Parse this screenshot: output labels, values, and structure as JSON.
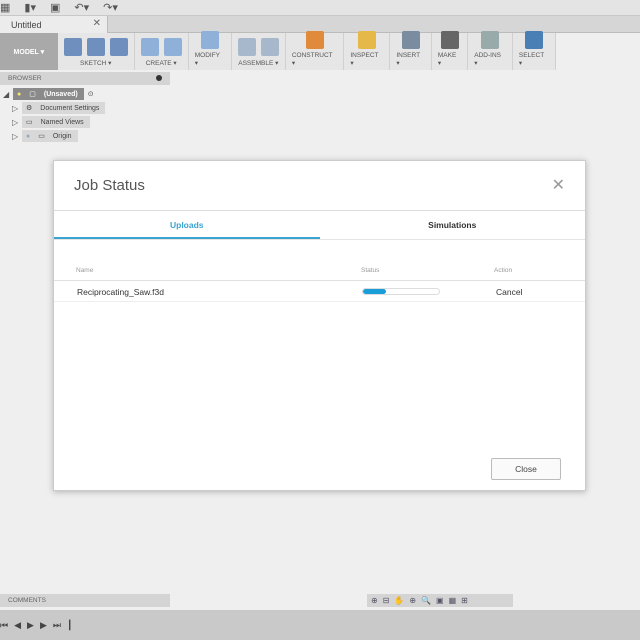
{
  "app": {
    "doc_tab": "Untitled",
    "quick": [
      "grid-icon",
      "file-icon",
      "save-icon",
      "undo-icon",
      "redo-icon"
    ]
  },
  "toolbar": {
    "workspace": "MODEL ▾",
    "groups": [
      {
        "label": "SKETCH ▾",
        "n": 3,
        "color": "#6f8fbf"
      },
      {
        "label": "CREATE ▾",
        "n": 2,
        "color": "#8fb0d8"
      },
      {
        "label": "MODIFY ▾",
        "n": 1,
        "color": "#8fb0d8"
      },
      {
        "label": "ASSEMBLE ▾",
        "n": 2,
        "color": "#a8b8cc"
      },
      {
        "label": "CONSTRUCT ▾",
        "n": 1,
        "color": "#e08a3c"
      },
      {
        "label": "INSPECT ▾",
        "n": 1,
        "color": "#e6b84a"
      },
      {
        "label": "INSERT ▾",
        "n": 1,
        "color": "#7a8da0"
      },
      {
        "label": "MAKE ▾",
        "n": 1,
        "color": "#666"
      },
      {
        "label": "ADD-INS ▾",
        "n": 1,
        "color": "#9aa"
      },
      {
        "label": "SELECT ▾",
        "n": 1,
        "color": "#4a7fb5"
      }
    ]
  },
  "browser": {
    "title": "BROWSER",
    "items": [
      "(Unsaved)",
      "Document Settings",
      "Named Views",
      "Origin"
    ]
  },
  "dialog": {
    "title": "Job Status",
    "close": "✕",
    "tabs": [
      "Uploads",
      "Simulations"
    ],
    "active_tab": "Uploads",
    "columns": [
      "Name",
      "Status",
      "Action"
    ],
    "rows": [
      {
        "name": "Reciprocating_Saw.f3d",
        "progress_percent": 30,
        "action": "Cancel"
      }
    ],
    "close_button": "Close",
    "accent": "#3aa4cf"
  },
  "comments": {
    "title": "COMMENTS"
  },
  "navbar": {
    "icons": [
      "orbit-icon",
      "look-at-icon",
      "pan-icon",
      "zoom-icon",
      "fit-icon",
      "display-icon",
      "grid-icon",
      "viewports-icon"
    ]
  },
  "timeline": {
    "controls": [
      "⏮",
      "◀",
      "▶",
      "▶",
      "⏭"
    ]
  }
}
